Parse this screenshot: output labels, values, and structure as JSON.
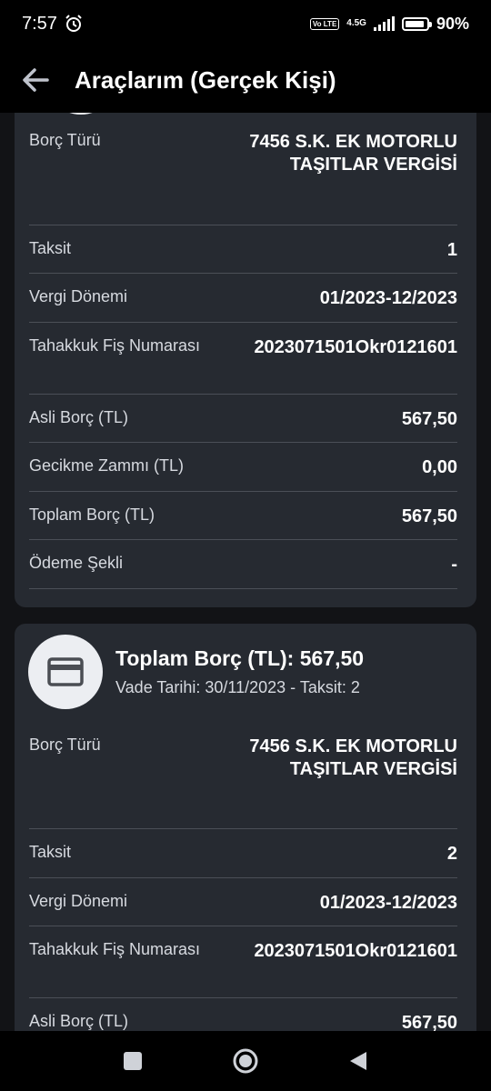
{
  "status": {
    "time": "7:57",
    "volte": "Vo LTE",
    "network": "4.5G",
    "battery": "90%"
  },
  "app": {
    "title": "Araçlarım (Gerçek Kişi)"
  },
  "card1": {
    "rows": [
      {
        "label": "Borç Türü",
        "value": "7456 S.K. EK MOTORLU TAŞITLAR VERGİSİ"
      },
      {
        "label": "Taksit",
        "value": "1"
      },
      {
        "label": "Vergi Dönemi",
        "value": "01/2023-12/2023"
      },
      {
        "label": "Tahakkuk Fiş Numarası",
        "value": "2023071501Okr0121601"
      },
      {
        "label": "Asli Borç (TL)",
        "value": "567,50"
      },
      {
        "label": "Gecikme Zammı (TL)",
        "value": "0,00"
      },
      {
        "label": "Toplam Borç (TL)",
        "value": "567,50"
      },
      {
        "label": "Ödeme Şekli",
        "value": "-"
      }
    ]
  },
  "card2": {
    "title": "Toplam Borç (TL): 567,50",
    "subtitle": "Vade Tarihi: 30/11/2023 - Taksit: 2",
    "rows": [
      {
        "label": "Borç Türü",
        "value": "7456 S.K. EK MOTORLU TAŞITLAR VERGİSİ"
      },
      {
        "label": "Taksit",
        "value": "2"
      },
      {
        "label": "Vergi Dönemi",
        "value": "01/2023-12/2023"
      },
      {
        "label": "Tahakkuk Fiş Numarası",
        "value": "2023071501Okr0121601"
      },
      {
        "label": "Asli Borç (TL)",
        "value": "567,50"
      }
    ]
  },
  "icons": {
    "back": "arrow-left-icon",
    "card": "credit-card-icon",
    "alarm": "alarm-icon"
  }
}
